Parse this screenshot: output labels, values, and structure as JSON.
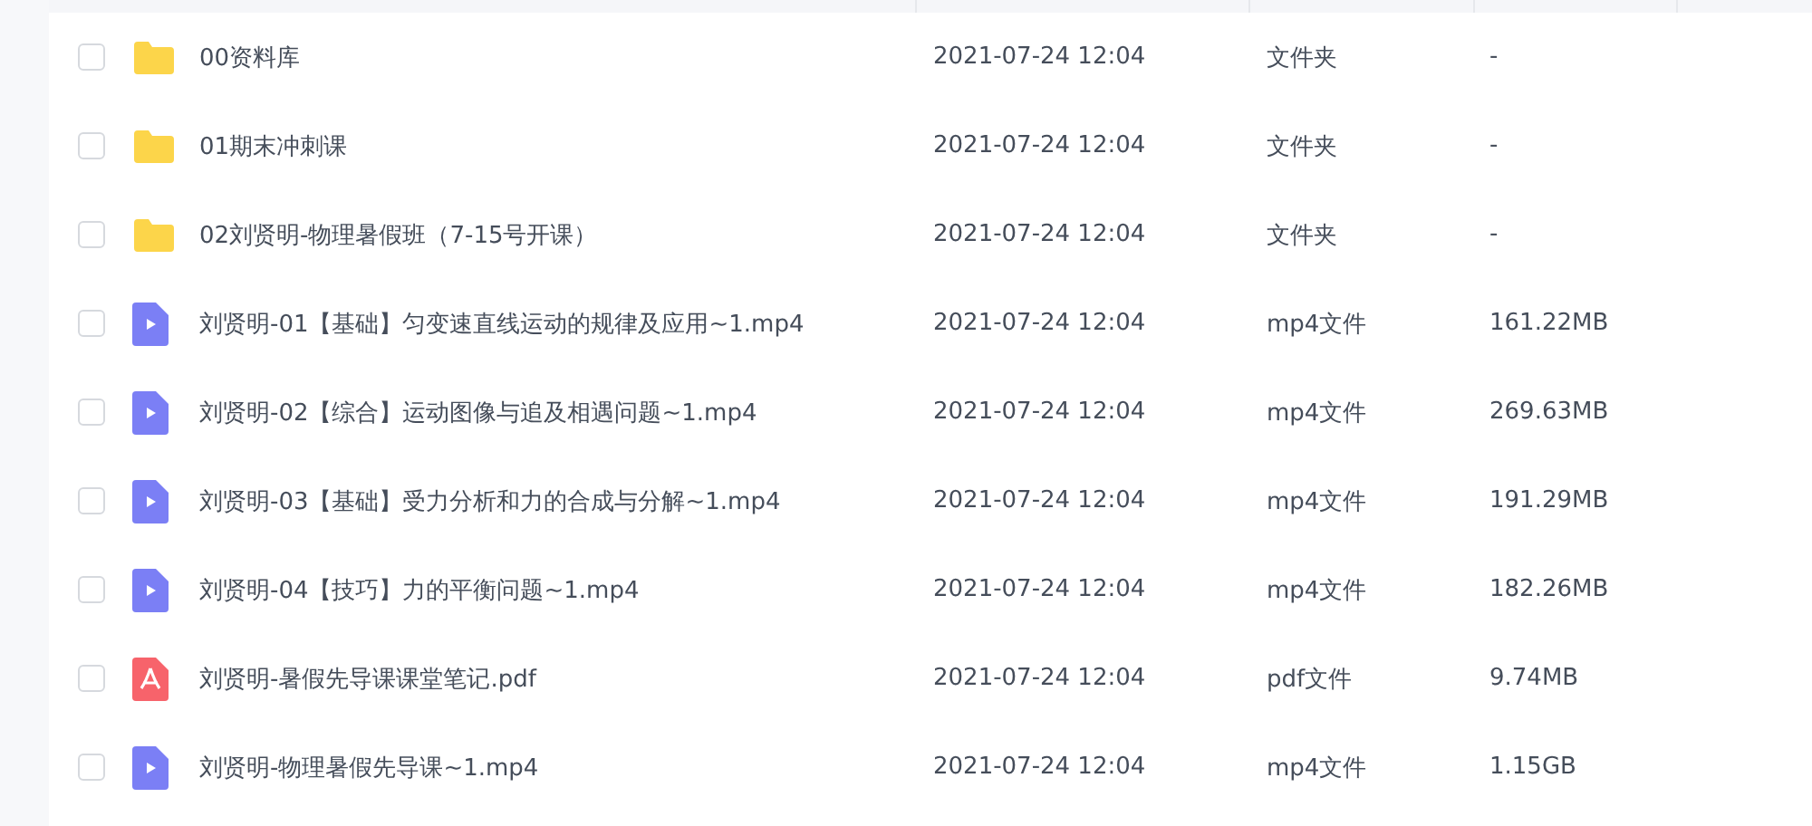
{
  "files": [
    {
      "kind": "folder",
      "checked": false,
      "name": "00资料库",
      "modified": "2021-07-24 12:04",
      "type": "文件夹",
      "size": "-"
    },
    {
      "kind": "folder",
      "checked": false,
      "name": "01期末冲刺课",
      "modified": "2021-07-24 12:04",
      "type": "文件夹",
      "size": "-"
    },
    {
      "kind": "folder",
      "checked": false,
      "name": "02刘贤明-物理暑假班（7-15号开课）",
      "modified": "2021-07-24 12:04",
      "type": "文件夹",
      "size": "-"
    },
    {
      "kind": "video",
      "checked": false,
      "name": "刘贤明-01【基础】匀变速直线运动的规律及应用~1.mp4",
      "modified": "2021-07-24 12:04",
      "type": "mp4文件",
      "size": "161.22MB"
    },
    {
      "kind": "video",
      "checked": false,
      "name": "刘贤明-02【综合】运动图像与追及相遇问题~1.mp4",
      "modified": "2021-07-24 12:04",
      "type": "mp4文件",
      "size": "269.63MB"
    },
    {
      "kind": "video",
      "checked": false,
      "name": "刘贤明-03【基础】受力分析和力的合成与分解~1.mp4",
      "modified": "2021-07-24 12:04",
      "type": "mp4文件",
      "size": "191.29MB"
    },
    {
      "kind": "video",
      "checked": false,
      "name": "刘贤明-04【技巧】力的平衡问题~1.mp4",
      "modified": "2021-07-24 12:04",
      "type": "mp4文件",
      "size": "182.26MB"
    },
    {
      "kind": "pdf",
      "checked": false,
      "name": "刘贤明-暑假先导课课堂笔记.pdf",
      "modified": "2021-07-24 12:04",
      "type": "pdf文件",
      "size": "9.74MB"
    },
    {
      "kind": "video",
      "checked": false,
      "name": "刘贤明-物理暑假先导课~1.mp4",
      "modified": "2021-07-24 12:04",
      "type": "mp4文件",
      "size": "1.15GB"
    }
  ]
}
